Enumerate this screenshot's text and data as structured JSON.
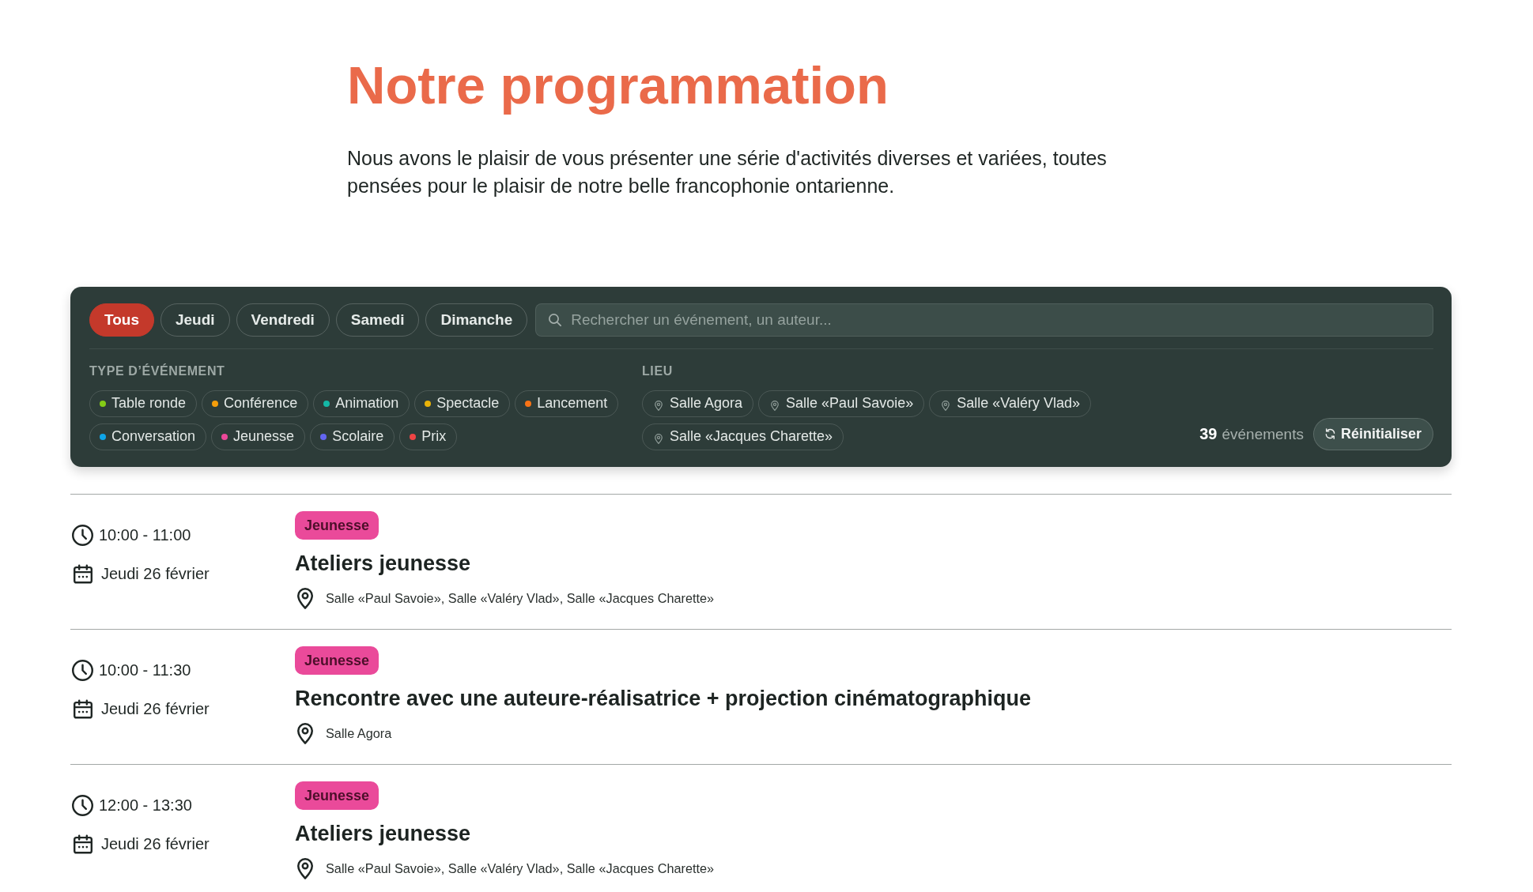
{
  "page": {
    "title": "Notre programmation",
    "intro": "Nous avons le plaisir de vous présenter une série d'activités diverses et variées, toutes pensées pour le plaisir de notre belle francophonie ontarienne."
  },
  "filters": {
    "days": [
      {
        "label": "Tous",
        "selected": true
      },
      {
        "label": "Jeudi",
        "selected": false
      },
      {
        "label": "Vendredi",
        "selected": false
      },
      {
        "label": "Samedi",
        "selected": false
      },
      {
        "label": "Dimanche",
        "selected": false
      }
    ],
    "search": {
      "placeholder": "Rechercher un événement, un auteur..."
    },
    "event_type_heading": "TYPE D’ÉVÉNEMENT",
    "event_types": [
      {
        "label": "Table ronde",
        "color": "#84cc16",
        "selected": false
      },
      {
        "label": "Conférence",
        "color": "#f59e0b",
        "selected": false
      },
      {
        "label": "Animation",
        "color": "#14b8a6",
        "selected": false
      },
      {
        "label": "Spectacle",
        "color": "#eab308",
        "selected": false
      },
      {
        "label": "Lancement",
        "color": "#f97316",
        "selected": false
      },
      {
        "label": "Conversation",
        "color": "#0ea5e9",
        "selected": false
      },
      {
        "label": "Jeunesse",
        "color": "#ec4899",
        "selected": false
      },
      {
        "label": "Scolaire",
        "color": "#6366f1",
        "selected": false
      },
      {
        "label": "Prix",
        "color": "#ef4444",
        "selected": false
      }
    ],
    "venue_heading": "LIEU",
    "venues": [
      {
        "label": "Salle Agora",
        "selected": false
      },
      {
        "label": "Salle «Paul Savoie»",
        "selected": false
      },
      {
        "label": "Salle «Valéry Vlad»",
        "selected": false
      },
      {
        "label": "Salle «Jacques Charette»",
        "selected": false
      }
    ],
    "count": "39",
    "count_label": "événements",
    "reset_button": "Réinitialiser"
  },
  "events": [
    {
      "time": "10:00 - 11:00",
      "date": "Jeudi 26 février",
      "category": {
        "label": "Jeunesse",
        "color": "#ea4a9a"
      },
      "title": "Ateliers jeunesse",
      "location": "Salle «Paul Savoie», Salle «Valéry Vlad», Salle «Jacques Charette»"
    },
    {
      "time": "10:00 - 11:30",
      "date": "Jeudi 26 février",
      "category": {
        "label": "Jeunesse",
        "color": "#ea4a9a"
      },
      "title": "Rencontre avec une auteure-réalisatrice + projection cinématographique",
      "location": "Salle Agora"
    },
    {
      "time": "12:00 - 13:30",
      "date": "Jeudi 26 février",
      "category": {
        "label": "Jeunesse",
        "color": "#ea4a9a"
      },
      "title": "Ateliers jeunesse",
      "location": "Salle «Paul Savoie», Salle «Valéry Vlad», Salle «Jacques Charette»"
    }
  ]
}
